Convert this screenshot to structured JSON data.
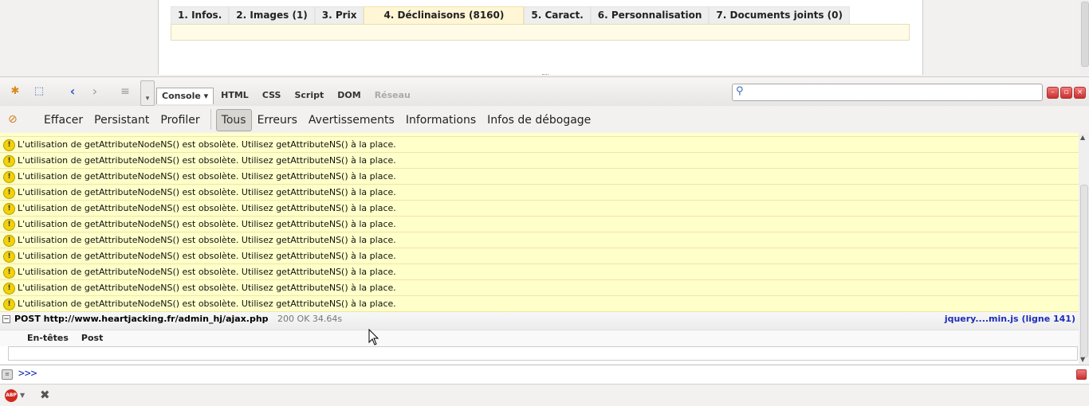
{
  "page": {
    "tabs": [
      {
        "label": "1. Infos."
      },
      {
        "label": "2. Images (1)"
      },
      {
        "label": "3. Prix"
      },
      {
        "label": "4. Déclinaisons (8160)",
        "active": true
      },
      {
        "label": "5. Caract."
      },
      {
        "label": "6. Personnalisation"
      },
      {
        "label": "7. Documents joints (0)"
      }
    ]
  },
  "firebug": {
    "panel_tabs": [
      {
        "label": "Console ▾",
        "active": true
      },
      {
        "label": "HTML"
      },
      {
        "label": "CSS"
      },
      {
        "label": "Script"
      },
      {
        "label": "DOM"
      },
      {
        "label": "Réseau",
        "disabled": true
      }
    ],
    "search": {
      "placeholder": ""
    },
    "icons": {
      "bug": "firebug-icon",
      "inspect": "inspect-icon",
      "back": "back-arrow-icon",
      "forward": "forward-arrow-icon",
      "menu": "menu-icon",
      "search": "magnifier-icon"
    }
  },
  "filters": {
    "actions": [
      "Effacer",
      "Persistant",
      "Profiler"
    ],
    "levels": [
      {
        "label": "Tous",
        "active": true
      },
      {
        "label": "Erreurs"
      },
      {
        "label": "Avertissements"
      },
      {
        "label": "Informations"
      },
      {
        "label": "Infos de débogage"
      }
    ]
  },
  "log": {
    "warnings": [
      "L'utilisation de getAttributeNodeNS() est obsolète. Utilisez getAttributeNS() à la place.",
      "L'utilisation de getAttributeNodeNS() est obsolète. Utilisez getAttributeNS() à la place.",
      "L'utilisation de getAttributeNodeNS() est obsolète. Utilisez getAttributeNS() à la place.",
      "L'utilisation de getAttributeNodeNS() est obsolète. Utilisez getAttributeNS() à la place.",
      "L'utilisation de getAttributeNodeNS() est obsolète. Utilisez getAttributeNS() à la place.",
      "L'utilisation de getAttributeNodeNS() est obsolète. Utilisez getAttributeNS() à la place.",
      "L'utilisation de getAttributeNodeNS() est obsolète. Utilisez getAttributeNS() à la place.",
      "L'utilisation de getAttributeNodeNS() est obsolète. Utilisez getAttributeNS() à la place.",
      "L'utilisation de getAttributeNodeNS() est obsolète. Utilisez getAttributeNS() à la place.",
      "L'utilisation de getAttributeNodeNS() est obsolète. Utilisez getAttributeNS() à la place.",
      "L'utilisation de getAttributeNodeNS() est obsolète. Utilisez getAttributeNS() à la place."
    ],
    "post": {
      "method_url": "POST http://www.heartjacking.fr/admin_hj/ajax.php",
      "status": "200 OK 34.64s",
      "source": "jquery....min.js (ligne 141)",
      "subtabs": [
        "En-têtes",
        "Post"
      ]
    }
  },
  "command": {
    "prompt": ">>>"
  },
  "colors": {
    "warning_bg": "#ffffc9",
    "link": "#1d2db8",
    "active_tab": "#fff6d6"
  }
}
